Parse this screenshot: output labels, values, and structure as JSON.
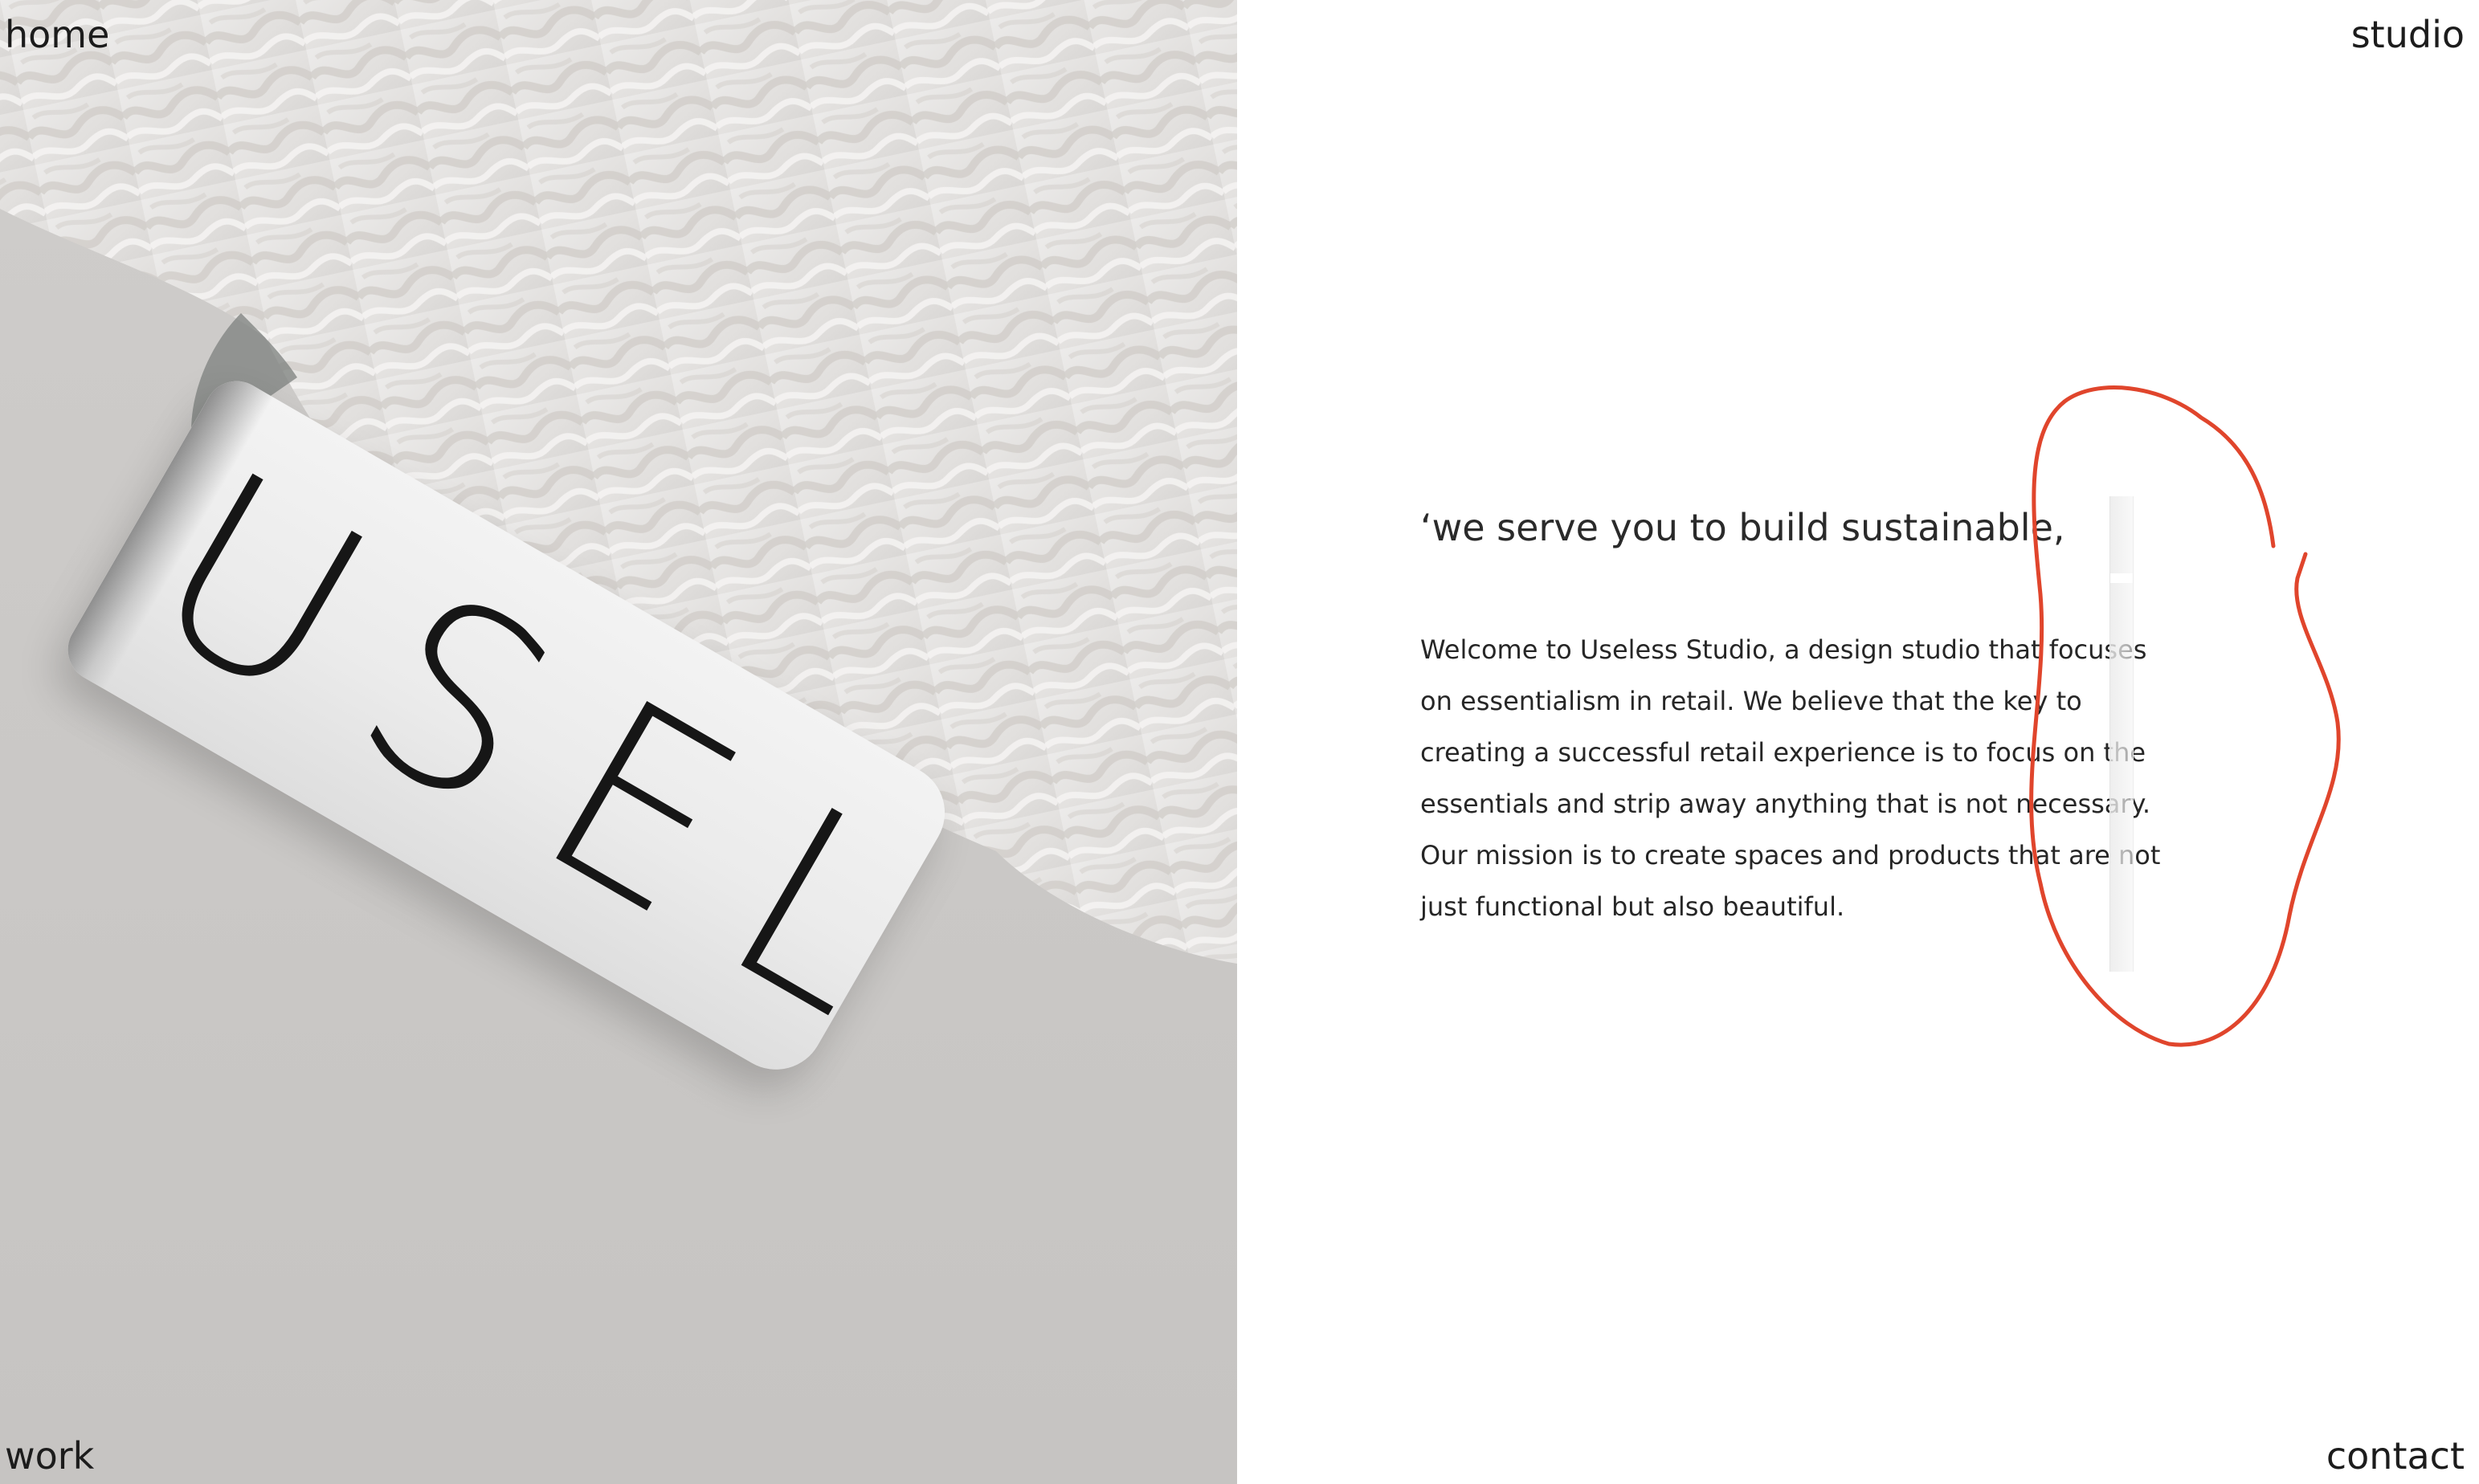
{
  "nav": {
    "home": "home",
    "studio": "studio",
    "work": "work",
    "contact": "contact"
  },
  "hero": {
    "label_text": "USELESS"
  },
  "main": {
    "tagline": "‘we serve you to build sustainable,",
    "body_lines": [
      "Welcome to Useless Studio, a design studio that focuses",
      "on essentialism in retail. We believe that the key to",
      "creating a successful retail experience is to focus on the",
      "essentials and strip away anything that is not necessary.",
      "Our mission is to create spaces and products that are not",
      "just functional but also beautiful."
    ]
  },
  "colors": {
    "background": "#ffffff",
    "text": "#1f1f1f",
    "annotation": "#e0452c",
    "hero_backdrop": "#c9c7c5"
  }
}
